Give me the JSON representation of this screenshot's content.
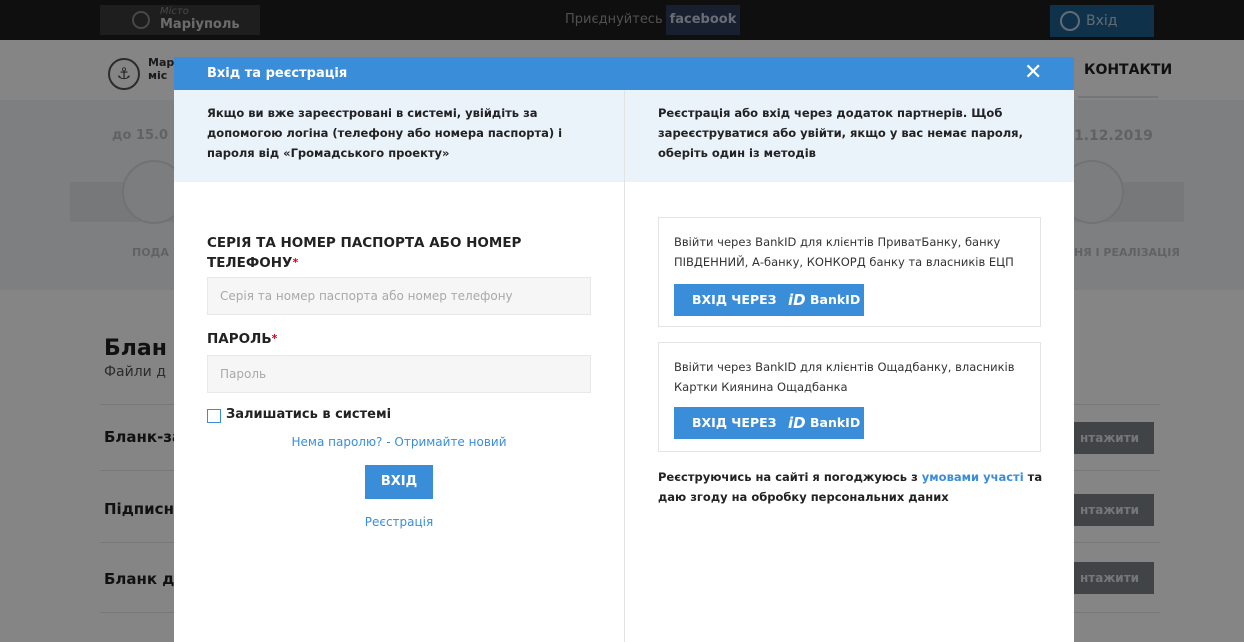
{
  "topbar": {
    "city_caption": "Місто",
    "city_name": "Маріуполь",
    "join_text": "Приєднуйтесь у",
    "facebook": "facebook",
    "login": "Вхід"
  },
  "header": {
    "logo_text_1": "Мар",
    "logo_text_2": "міс",
    "contacts": "КОНТАКТИ"
  },
  "stages": {
    "left_date": "до 15.0",
    "right_date": "1.12.2019",
    "left_label": "ПОДА",
    "right_label": "НЯ І РЕАЛІЗАЦІЯ"
  },
  "blanks": {
    "title": "Блан",
    "subtitle": "Файли д",
    "rows": [
      {
        "label": "Бланк-за",
        "button": "нтажити"
      },
      {
        "label": "Підписн",
        "button": "нтажити"
      },
      {
        "label": "Бланк д",
        "button": "нтажити"
      }
    ]
  },
  "modal": {
    "title": "Вхід та реєстрація",
    "close": "✕",
    "left_info": "Якщо ви вже зареєстровані в системі, увійдіть за допомогою логіна (телефону або номера паспорта) і пароля від «Громадського проекту»",
    "right_info": "Реєстрація або вхід через додаток партнерів. Щоб зареєструватися або увійти, якщо у вас немає пароля, оберіть один із методів",
    "passport_label": "СЕРІЯ ТА НОМЕР ПАСПОРТА АБО НОМЕР ТЕЛЕФОНУ",
    "passport_placeholder": "Серія та номер паспорта або номер телефону",
    "password_label": "ПАРОЛЬ",
    "password_placeholder": "Пароль",
    "required_mark": "*",
    "remember": "Залишатись в системі",
    "forgot": "Нема паролю? - Отримайте новий",
    "login_button": "ВХІД",
    "register": "Реєстрація",
    "bankid_cards": [
      {
        "text": "Ввійти через BankID для клієнтів ПриватБанку, банку ПІВДЕННИЙ, А-банку, КОНКОРД банку та власників ЕЦП",
        "button": "ВХІД ЧЕРЕЗ",
        "button_brand": "BankID",
        "button_logo": "iD"
      },
      {
        "text": "Ввійти через BankID для клієнтів Ощадбанку, власників Картки Киянина Ощадбанка",
        "button": "ВХІД ЧЕРЕЗ",
        "button_brand": "BankID",
        "button_logo": "iD"
      }
    ],
    "agree_prefix": "Реєструючись на сайті я погоджуюсь з",
    "agree_link": "умовами участі",
    "agree_suffix": "та даю згоду на обробку персональних даних"
  },
  "colors": {
    "accent": "#3a8ed9",
    "info_bg": "#eaf2fa",
    "required": "#d0021b"
  }
}
